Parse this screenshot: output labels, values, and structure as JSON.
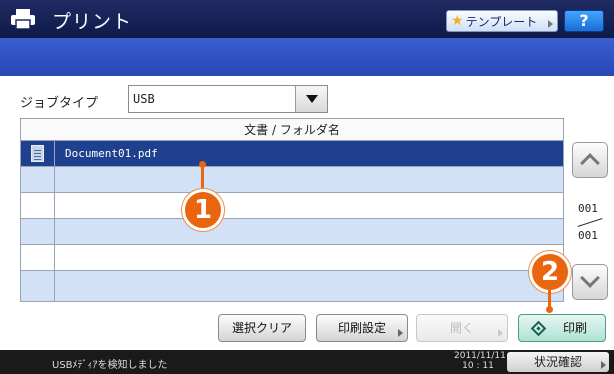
{
  "header": {
    "title": "プリント",
    "template_label": "テンプレート",
    "help_label": "?"
  },
  "job_type": {
    "label": "ジョブタイプ",
    "value": "USB"
  },
  "file_list": {
    "column_header": "文書 / フォルダ名",
    "items": [
      {
        "name": "Document01.pdf",
        "selected": true
      }
    ]
  },
  "pagination": {
    "current": "001",
    "total": "001"
  },
  "actions": {
    "clear_label": "選択クリア",
    "settings_label": "印刷設定",
    "open_label": "開く",
    "print_label": "印刷"
  },
  "callouts": {
    "one": "1",
    "two": "2"
  },
  "status": {
    "message": "USBﾒﾃﾞｨｱを検知しました",
    "date": "2011/11/11",
    "time": "10 : 11",
    "job_status_label": "状況確認"
  },
  "colors": {
    "title_bar": "#0f1a4a",
    "band": "#2f53c2",
    "selected_row": "#1f3f8f",
    "alt_row": "#d2e1f5",
    "callout": "#e9660f",
    "print_button": "#aee2d4"
  }
}
